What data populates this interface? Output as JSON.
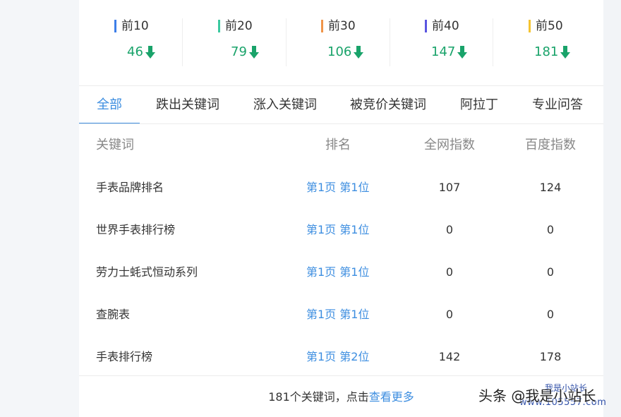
{
  "stats": [
    {
      "label": "前10",
      "value": "46",
      "color": "#3d7ee8"
    },
    {
      "label": "前20",
      "value": "79",
      "color": "#3cc9a0"
    },
    {
      "label": "前30",
      "value": "106",
      "color": "#f0954a"
    },
    {
      "label": "前40",
      "value": "147",
      "color": "#5a55e0"
    },
    {
      "label": "前50",
      "value": "181",
      "color": "#f5c431"
    }
  ],
  "tabs": [
    "全部",
    "跌出关键词",
    "涨入关键词",
    "被竞价关键词",
    "阿拉丁",
    "专业问答"
  ],
  "table": {
    "headers": [
      "关键词",
      "排名",
      "全网指数",
      "百度指数"
    ],
    "rows": [
      {
        "keyword": "手表品牌排名",
        "rank": "第1页 第1位",
        "all_index": "107",
        "baidu_index": "124"
      },
      {
        "keyword": "世界手表排行榜",
        "rank": "第1页 第1位",
        "all_index": "0",
        "baidu_index": "0"
      },
      {
        "keyword": "劳力士蚝式恒动系列",
        "rank": "第1页 第1位",
        "all_index": "0",
        "baidu_index": "0"
      },
      {
        "keyword": "查腕表",
        "rank": "第1页 第1位",
        "all_index": "0",
        "baidu_index": "0"
      },
      {
        "keyword": "手表排行榜",
        "rank": "第1页 第2位",
        "all_index": "142",
        "baidu_index": "178"
      }
    ]
  },
  "footer": {
    "text": "181个关键词，点击",
    "link": "查看更多"
  },
  "watermark": {
    "main": "头条 @我是小站长",
    "url": "www.105557.com",
    "faint": "我是小站长"
  }
}
